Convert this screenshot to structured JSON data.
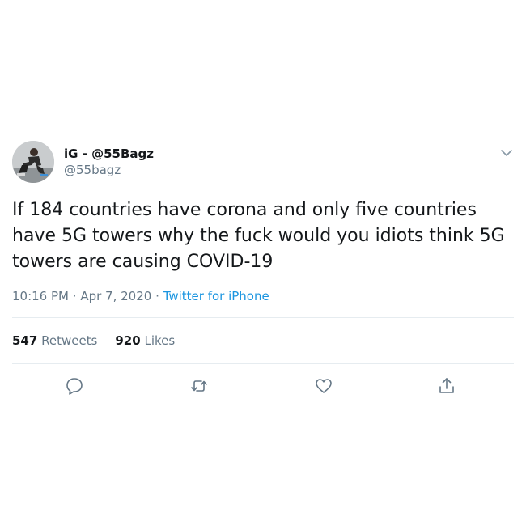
{
  "user": {
    "display_name": "iG - @55Bagz",
    "handle": "@55bagz",
    "avatar_icon": "avatar-photo"
  },
  "tweet": {
    "text": "If 184 countries have corona and only five countries\nhave 5G towers why the fuck would you idiots think 5G\ntowers are causing COVID-19",
    "time": "10:16 PM",
    "separator": "·",
    "date": "Apr 7, 2020",
    "source": "Twitter for iPhone"
  },
  "stats": {
    "retweets_count": "547",
    "retweets_label": "Retweets",
    "likes_count": "920",
    "likes_label": "Likes"
  },
  "icons": {
    "caret": "chevron-down-icon",
    "reply": "reply-icon",
    "retweet": "retweet-icon",
    "like": "heart-icon",
    "share": "share-icon"
  },
  "colors": {
    "text": "#14171a",
    "secondary": "#657786",
    "link": "#1b95e0",
    "divider": "#e6ecf0"
  }
}
